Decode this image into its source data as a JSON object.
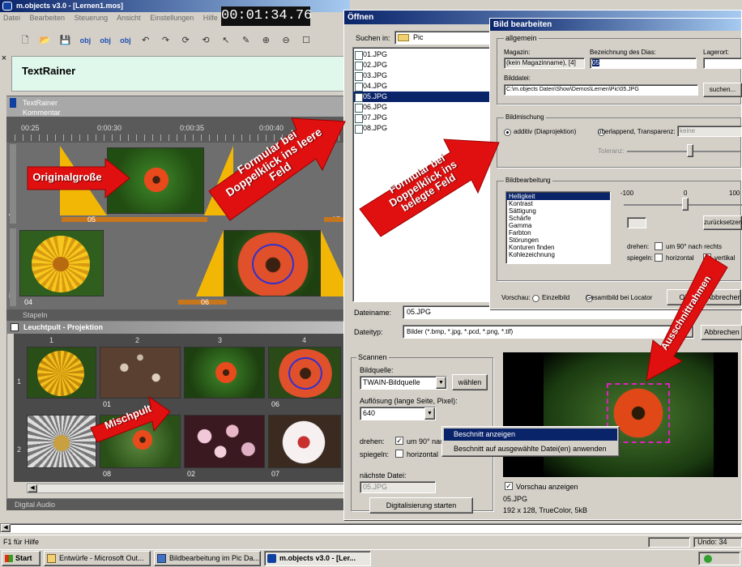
{
  "main_window": {
    "title": "m.objects v3.0 - [Lernen1.mos]",
    "menu": [
      "Datei",
      "Bearbeiten",
      "Steuerung",
      "Ansicht",
      "Einstellungen",
      "Hilfe"
    ],
    "timer": "00:01:34.76",
    "text_track_title": "TextRainer",
    "text_track_label": "TextRainer",
    "timeline_header": "Kommentar",
    "ruler": [
      "00:25",
      "0:00:30",
      "0:00:35",
      "0:00:40"
    ],
    "marker_labels": [
      "05",
      "07",
      "04",
      "06"
    ],
    "track_labels": [
      "A",
      "B"
    ],
    "stack_label": "Stapeln",
    "lightbox_title": "Leuchtpult - Projektion",
    "lightbox_cols": [
      "1",
      "2",
      "3",
      "4"
    ],
    "lightbox_rows": [
      "1",
      "2"
    ],
    "lightbox_captions": [
      "01",
      "06",
      "08",
      "02",
      "07"
    ],
    "digital_audio": "Digital Audio",
    "status_help": "F1 für Hilfe",
    "status_undo": "Undo: 34"
  },
  "annotations": {
    "original_size": "Originalgroße",
    "empty_field": "Formular bei Doppelklick ins leere Feld",
    "filled_field": "Formular bei Doppelklick ins belegte Feld",
    "mixer": "Mischpult",
    "crop_frame": "Ausschnittrahmen"
  },
  "open_dialog": {
    "title": "Öffnen",
    "search_in_label": "Suchen in:",
    "search_in_value": "Pic",
    "files": [
      "01.JPG",
      "02.JPG",
      "03.JPG",
      "04.JPG",
      "05.JPG",
      "06.JPG",
      "07.JPG",
      "08.JPG"
    ],
    "selected_file_index": 4,
    "filename_label": "Dateiname:",
    "filename_value": "05.JPG",
    "filetype_label": "Dateityp:",
    "filetype_value": "Bilder (*.bmp, *.jpg, *.pcd, *.png, *.tif)",
    "cancel": "Abbrechen",
    "scan_group": "Scannen",
    "source_label": "Bildquelle:",
    "source_value": "TWAIN-Bildquelle",
    "choose_button": "wählen",
    "resolution_label": "Auflösung (lange Seite, Pixel):",
    "resolution_value": "640",
    "rotate_label": "drehen:",
    "rotate_option": "um 90° nach rechts",
    "mirror_label": "spiegeln:",
    "mirror_option": "horizontal",
    "next_file_label": "nächste Datei:",
    "next_file_value": "05.JPG",
    "digitize_button": "Digitalisierung starten",
    "preview_checkbox": "Vorschau anzeigen",
    "preview_filename": "05.JPG",
    "preview_info": "192 x 128, TrueColor, 5kB"
  },
  "context_menu": {
    "items": [
      "Beschnitt anzeigen",
      "Beschnitt auf ausgewählte Datei(en) anwenden"
    ]
  },
  "edit_dialog": {
    "title": "Bild bearbeiten",
    "general_group": "allgemein",
    "magazine_label": "Magazin:",
    "magazine_value": "(kein Magazinname), [4]",
    "slide_label": "Bezeichnung des Dias:",
    "slide_value": "05",
    "location_label": "Lagerort:",
    "file_label": "Bilddatei:",
    "file_value": "C:\\m.objects Daten\\Show\\Demos\\Lernen\\Pic\\05.JPG",
    "search_button": "suchen...",
    "mixing_group": "Bildmischung",
    "mix_additive": "additiv (Diaprojektion)",
    "mix_overlap": "überlappend, Transparenz:",
    "mix_overlap_value": "keine",
    "tolerance_label": "Toleranz:",
    "edit_group": "Bildbearbeitung",
    "edit_list": [
      "Helligkeit",
      "Kontrast",
      "Sättigung",
      "Schärfe",
      "Gamma",
      "Farbton",
      "Störungen",
      "Konturen finden",
      "Kohlezeichnung"
    ],
    "selected_edit_index": 0,
    "scale_ticks": [
      "-100",
      "0",
      "100"
    ],
    "reset_button": "zurücksetzen",
    "rotate_label": "drehen:",
    "rotate_option": "um 90° nach rechts",
    "mirror_label": "spiegeln:",
    "mirror_h": "horizontal",
    "mirror_v": "vertikal",
    "preview_label": "Vorschau:",
    "preview_single": "Einzelbild",
    "preview_all": "Gesamtbild bei Locator",
    "ok_button": "OK",
    "cancel_button": "Abbrechen"
  },
  "taskbar": {
    "start": "Start",
    "items": [
      "Entwürfe - Microsoft Out...",
      "Bildbearbeitung im Pic Da...",
      "m.objects v3.0 - [Ler..."
    ],
    "active_index": 2
  }
}
